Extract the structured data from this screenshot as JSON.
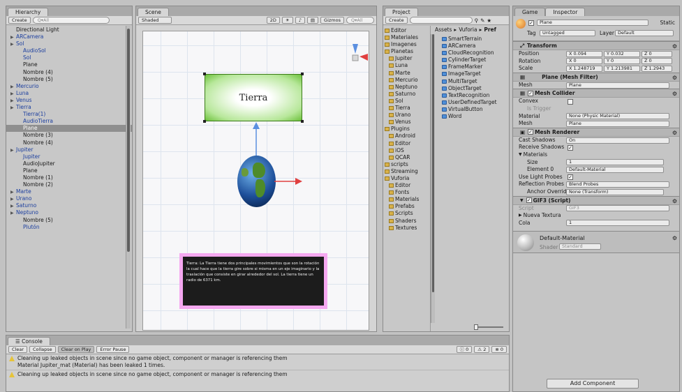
{
  "hierarchy": {
    "tab": "Hierarchy",
    "create": "Create",
    "search_placeholder": "Q▾All",
    "items": [
      {
        "label": "Directional Light",
        "indent": 0,
        "blue": false,
        "arrow": false,
        "selected": false
      },
      {
        "label": "ARCamera",
        "indent": 0,
        "blue": true,
        "arrow": true,
        "selected": false
      },
      {
        "label": "Sol",
        "indent": 0,
        "blue": true,
        "arrow": true,
        "selected": false
      },
      {
        "label": "AudioSol",
        "indent": 1,
        "blue": true,
        "arrow": false,
        "selected": false
      },
      {
        "label": "Sol",
        "indent": 1,
        "blue": true,
        "arrow": false,
        "selected": false
      },
      {
        "label": "Plane",
        "indent": 1,
        "blue": false,
        "arrow": false,
        "selected": false
      },
      {
        "label": "Nombre (4)",
        "indent": 1,
        "blue": false,
        "arrow": false,
        "selected": false
      },
      {
        "label": "Nombre (5)",
        "indent": 1,
        "blue": false,
        "arrow": false,
        "selected": false
      },
      {
        "label": "Mercurio",
        "indent": 0,
        "blue": true,
        "arrow": true,
        "selected": false
      },
      {
        "label": "Luna",
        "indent": 0,
        "blue": true,
        "arrow": true,
        "selected": false
      },
      {
        "label": "Venus",
        "indent": 0,
        "blue": true,
        "arrow": true,
        "selected": false
      },
      {
        "label": "Tierra",
        "indent": 0,
        "blue": true,
        "arrow": true,
        "selected": false
      },
      {
        "label": "Tierra(1)",
        "indent": 1,
        "blue": true,
        "arrow": false,
        "selected": false
      },
      {
        "label": "AudioTierra",
        "indent": 1,
        "blue": true,
        "arrow": false,
        "selected": false
      },
      {
        "label": "Plane",
        "indent": 1,
        "blue": false,
        "arrow": false,
        "selected": true
      },
      {
        "label": "Nombre (3)",
        "indent": 1,
        "blue": false,
        "arrow": false,
        "selected": false
      },
      {
        "label": "Nombre (4)",
        "indent": 1,
        "blue": false,
        "arrow": false,
        "selected": false
      },
      {
        "label": "Jupiter",
        "indent": 0,
        "blue": true,
        "arrow": true,
        "selected": false
      },
      {
        "label": "Jupiter",
        "indent": 1,
        "blue": true,
        "arrow": false,
        "selected": false
      },
      {
        "label": "AudioJupiter",
        "indent": 1,
        "blue": false,
        "arrow": false,
        "selected": false
      },
      {
        "label": "Plane",
        "indent": 1,
        "blue": false,
        "arrow": false,
        "selected": false
      },
      {
        "label": "Nombre (1)",
        "indent": 1,
        "blue": false,
        "arrow": false,
        "selected": false
      },
      {
        "label": "Nombre (2)",
        "indent": 1,
        "blue": false,
        "arrow": false,
        "selected": false
      },
      {
        "label": "Marte",
        "indent": 0,
        "blue": true,
        "arrow": true,
        "selected": false
      },
      {
        "label": "Urano",
        "indent": 0,
        "blue": true,
        "arrow": true,
        "selected": false
      },
      {
        "label": "Saturno",
        "indent": 0,
        "blue": true,
        "arrow": true,
        "selected": false
      },
      {
        "label": "Neptuno",
        "indent": 0,
        "blue": true,
        "arrow": true,
        "selected": false
      },
      {
        "label": "Nombre (5)",
        "indent": 1,
        "blue": false,
        "arrow": false,
        "selected": false
      },
      {
        "label": "Plutón",
        "indent": 1,
        "blue": true,
        "arrow": false,
        "selected": false
      }
    ]
  },
  "scene": {
    "tab": "Scene",
    "shading": "Shaded",
    "mode_2d": "2D",
    "gizmos": "Gizmos",
    "search_placeholder": "Q▾All",
    "card_title": "Tierra",
    "description": "Tierra: La Tierra tiene dos principales movimientos que son la rotación la cual hace que la tierra gire sobre si misma en un eje imaginario y la traslación que consiste en girar alrededor del sol. La tierra tiene un radio de 6371 km."
  },
  "project": {
    "tab": "Project",
    "create": "Create",
    "breadcrumb": [
      "Assets",
      "Vuforia",
      "Pref"
    ],
    "folders": [
      {
        "label": "Editor",
        "indent": 0
      },
      {
        "label": "Materiales",
        "indent": 0
      },
      {
        "label": "Imagenes",
        "indent": 0
      },
      {
        "label": "Planetas",
        "indent": 0
      },
      {
        "label": "Jupiter",
        "indent": 1
      },
      {
        "label": "Luna",
        "indent": 1
      },
      {
        "label": "Marte",
        "indent": 1
      },
      {
        "label": "Mercurio",
        "indent": 1
      },
      {
        "label": "Neptuno",
        "indent": 1
      },
      {
        "label": "Saturno",
        "indent": 1
      },
      {
        "label": "Sol",
        "indent": 1
      },
      {
        "label": "Tierra",
        "indent": 1
      },
      {
        "label": "Urano",
        "indent": 1
      },
      {
        "label": "Venus",
        "indent": 1
      },
      {
        "label": "Plugins",
        "indent": 0
      },
      {
        "label": "Android",
        "indent": 1
      },
      {
        "label": "Editor",
        "indent": 1
      },
      {
        "label": "iOS",
        "indent": 1
      },
      {
        "label": "QCAR",
        "indent": 1
      },
      {
        "label": "scripts",
        "indent": 0
      },
      {
        "label": "Streaming",
        "indent": 0
      },
      {
        "label": "Vuforia",
        "indent": 0
      },
      {
        "label": "Editor",
        "indent": 1
      },
      {
        "label": "Fonts",
        "indent": 1
      },
      {
        "label": "Materials",
        "indent": 1
      },
      {
        "label": "Prefabs",
        "indent": 1
      },
      {
        "label": "Scripts",
        "indent": 1
      },
      {
        "label": "Shaders",
        "indent": 1
      },
      {
        "label": "Textures",
        "indent": 1
      }
    ],
    "assets": [
      "SmartTerrain",
      "ARCamera",
      "CloudRecognition",
      "CylinderTarget",
      "FrameMarker",
      "ImageTarget",
      "MultiTarget",
      "ObjectTarget",
      "TextRecognition",
      "UserDefinedTarget",
      "VirtualButton",
      "Word"
    ]
  },
  "inspector": {
    "tab_game": "Game",
    "tab_inspector": "Inspector",
    "object_name": "Plane",
    "static_label": "Static",
    "tag_label": "Tag",
    "tag_value": "Untagged",
    "layer_label": "Layer",
    "layer_value": "Default",
    "transform": {
      "title": "Transform",
      "position_label": "Position",
      "position": [
        "X 0.094",
        "Y 0.032",
        "Z 0"
      ],
      "rotation_label": "Rotation",
      "rotation": [
        "X 0",
        "Y 0",
        "Z 0"
      ],
      "scale_label": "Scale",
      "scale": [
        "X 1.248719",
        "Y 1.213981",
        "Z 1.2943"
      ]
    },
    "mesh_filter": {
      "title": "Plane (Mesh Filter)",
      "mesh_label": "Mesh",
      "mesh_value": "Plane"
    },
    "mesh_collider": {
      "title": "Mesh Collider",
      "convex_label": "Convex",
      "trigger_label": "Is Trigger",
      "material_label": "Material",
      "material_value": "None (Physic Material)",
      "mesh_label": "Mesh",
      "mesh_value": "Plane"
    },
    "mesh_renderer": {
      "title": "Mesh Renderer",
      "cast_label": "Cast Shadows",
      "cast_value": "On",
      "receive_label": "Receive Shadows",
      "materials_label": "Materials",
      "size_label": "Size",
      "size_value": "1",
      "element_label": "Element 0",
      "element_value": "Default-Material",
      "light_label": "Use Light Probes",
      "reflection_label": "Reflection Probes",
      "reflection_value": "Blend Probes",
      "anchor_label": "Anchor Override",
      "anchor_value": "None (Transform)"
    },
    "script_comp": {
      "title": "GIF3 (Script)",
      "script_label": "Script",
      "script_value": "GIF3",
      "nueva_label": "Nueva Textura",
      "cola_label": "Cola",
      "cola_value": "1"
    },
    "material": {
      "name": "Default-Material",
      "shader_label": "Shader",
      "shader_value": "Standard"
    },
    "add_component": "Add Component"
  },
  "console": {
    "tab": "Console",
    "buttons": [
      "Clear",
      "Collapse",
      "Clear on Play",
      "Error Pause"
    ],
    "counts": [
      "0",
      "2",
      "0"
    ],
    "messages": [
      {
        "line1": "Cleaning up leaked objects in scene since no game object, component or manager is referencing them",
        "line2": "Material Jupiter_mat (Material) has been leaked 1 times."
      },
      {
        "line1": "Cleaning up leaked objects in scene since no game object, component or manager is referencing them",
        "line2": ""
      }
    ]
  },
  "colors": {
    "selection": "#8f8f8f",
    "accent_blue": "#1b3e9e",
    "card_green": "#6cc13b",
    "desc_pink": "#f5a8f0"
  }
}
